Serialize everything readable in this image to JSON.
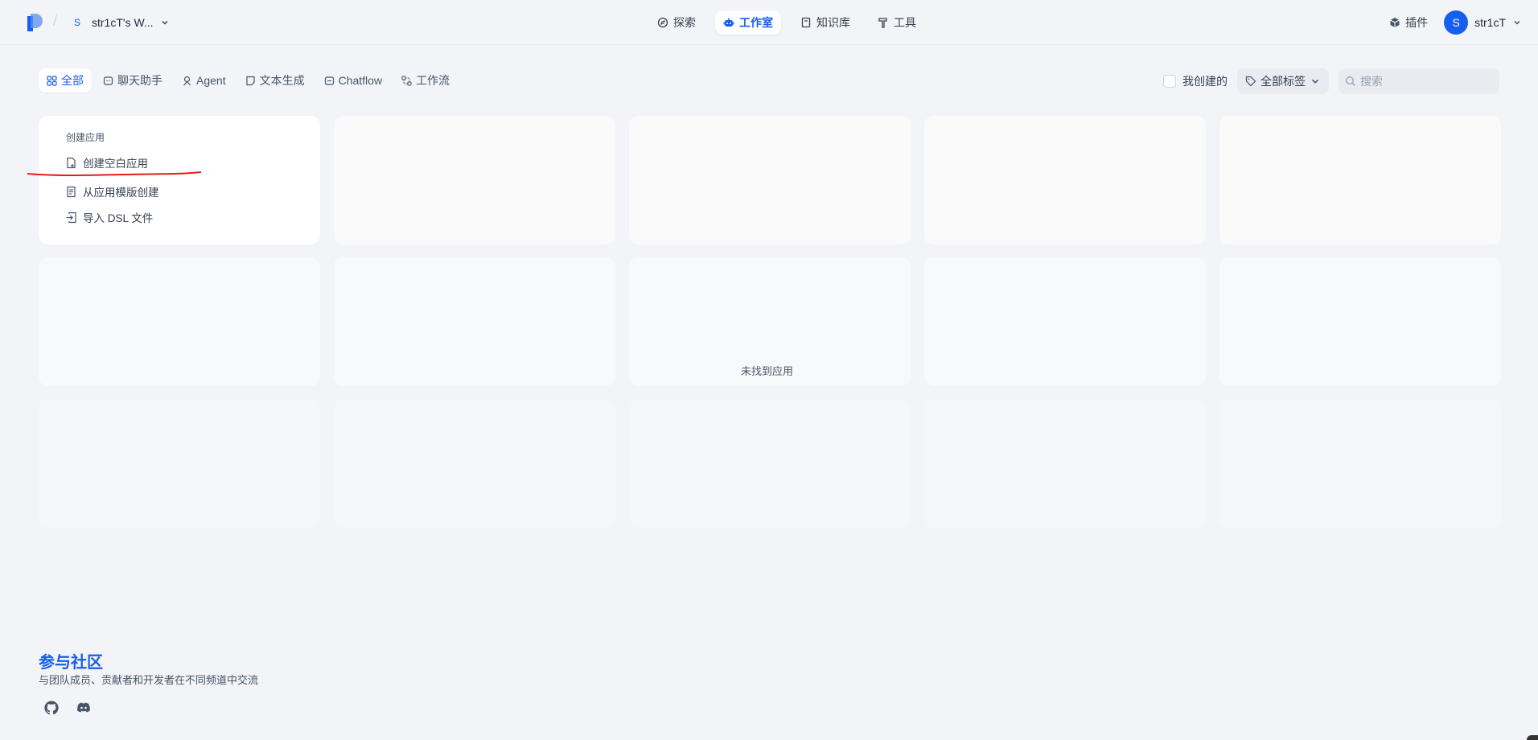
{
  "header": {
    "workspace_avatar": "S",
    "workspace_name": "str1cT's W...",
    "nav": [
      {
        "label": "探索",
        "icon": "compass-icon"
      },
      {
        "label": "工作室",
        "icon": "robot-icon",
        "active": true
      },
      {
        "label": "知识库",
        "icon": "book-icon"
      },
      {
        "label": "工具",
        "icon": "hammer-icon"
      }
    ],
    "plugin_label": "插件",
    "user_avatar": "S",
    "user_name": "str1cT"
  },
  "filters": {
    "tabs": [
      {
        "label": "全部",
        "icon": "grid-icon",
        "active": true
      },
      {
        "label": "聊天助手",
        "icon": "chat-icon"
      },
      {
        "label": "Agent",
        "icon": "agent-icon"
      },
      {
        "label": "文本生成",
        "icon": "doc-icon"
      },
      {
        "label": "Chatflow",
        "icon": "chatflow-icon"
      },
      {
        "label": "工作流",
        "icon": "workflow-icon"
      }
    ],
    "created_by_me": "我创建的",
    "tags_label": "全部标签",
    "search_placeholder": "搜索"
  },
  "create_card": {
    "title": "创建应用",
    "items": [
      "创建空白应用",
      "从应用模版创建",
      "导入 DSL 文件"
    ]
  },
  "empty_text": "未找到应用",
  "community": {
    "title": "参与社区",
    "desc": "与团队成员、贡献者和开发者在不同频道中交流"
  },
  "colors": {
    "accent": "#155eef",
    "background": "#f2f4f7",
    "annotation": "#e0201c"
  }
}
